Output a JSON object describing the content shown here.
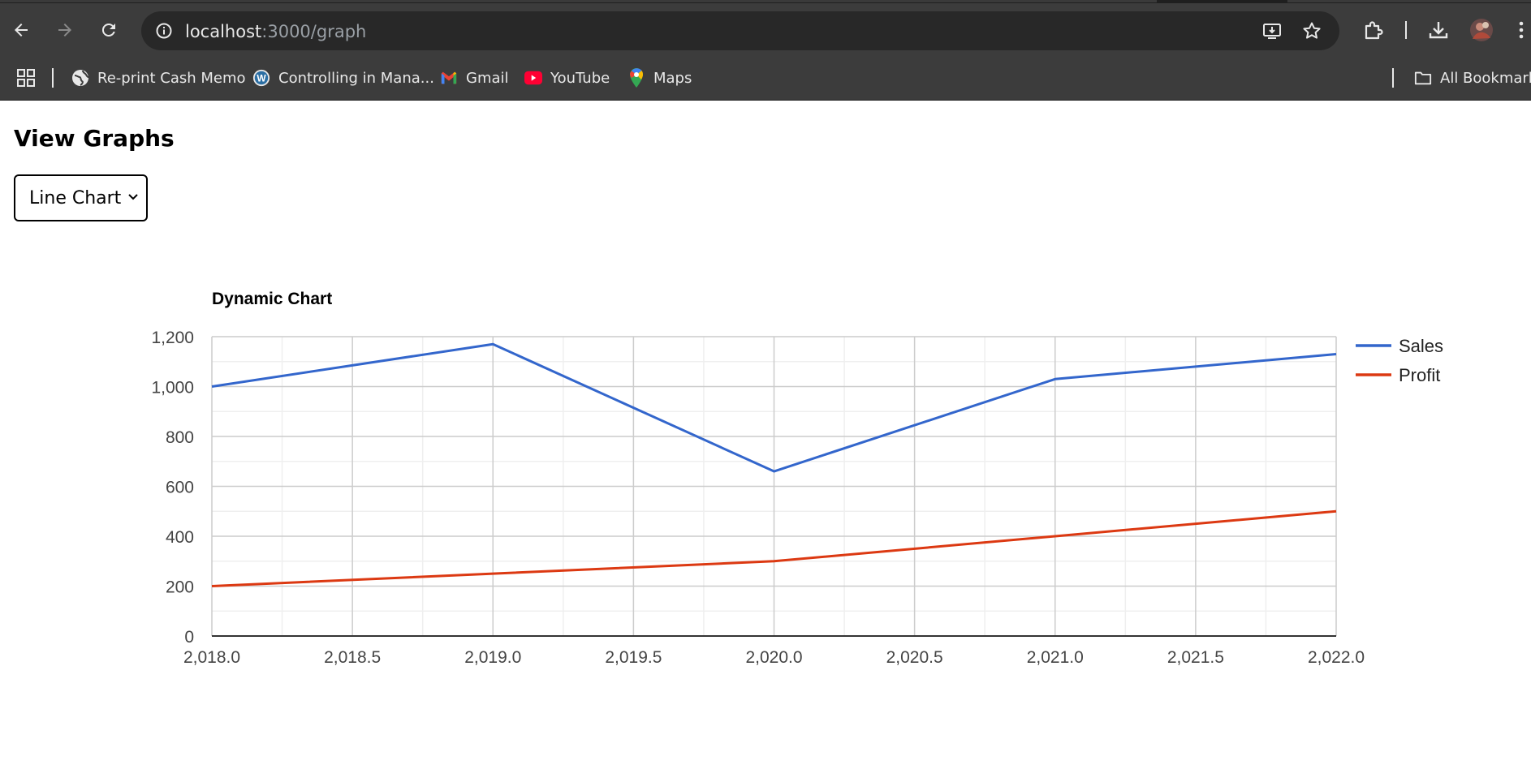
{
  "browser": {
    "url_host": "localhost",
    "url_path": ":3000/graph",
    "bookmarks": [
      {
        "label": "Re-print Cash Memo",
        "icon": "globe-icon"
      },
      {
        "label": "Controlling in Mana...",
        "icon": "wordpress-icon"
      },
      {
        "label": "Gmail",
        "icon": "gmail-icon"
      },
      {
        "label": "YouTube",
        "icon": "youtube-icon"
      },
      {
        "label": "Maps",
        "icon": "maps-icon"
      }
    ],
    "all_bookmarks_label": "All Bookmarks"
  },
  "page": {
    "title": "View Graphs",
    "chart_select": {
      "selected": "Line Chart"
    }
  },
  "chart_data": {
    "type": "line",
    "title": "Dynamic Chart",
    "x": [
      2018,
      2019,
      2020,
      2021,
      2022
    ],
    "series": [
      {
        "name": "Sales",
        "values": [
          1000,
          1170,
          660,
          1030,
          1130
        ],
        "color": "#3366cc"
      },
      {
        "name": "Profit",
        "values": [
          200,
          250,
          300,
          400,
          500
        ],
        "color": "#dc3912"
      }
    ],
    "xlim": [
      2018,
      2022
    ],
    "ylim": [
      0,
      1200
    ],
    "x_tick_labels": [
      "2,018.0",
      "2,018.5",
      "2,019.0",
      "2,019.5",
      "2,020.0",
      "2,020.5",
      "2,021.0",
      "2,021.5",
      "2,022.0"
    ],
    "y_tick_labels": [
      "0",
      "200",
      "400",
      "600",
      "800",
      "1,000",
      "1,200"
    ],
    "grid": true,
    "legend_position": "right"
  }
}
